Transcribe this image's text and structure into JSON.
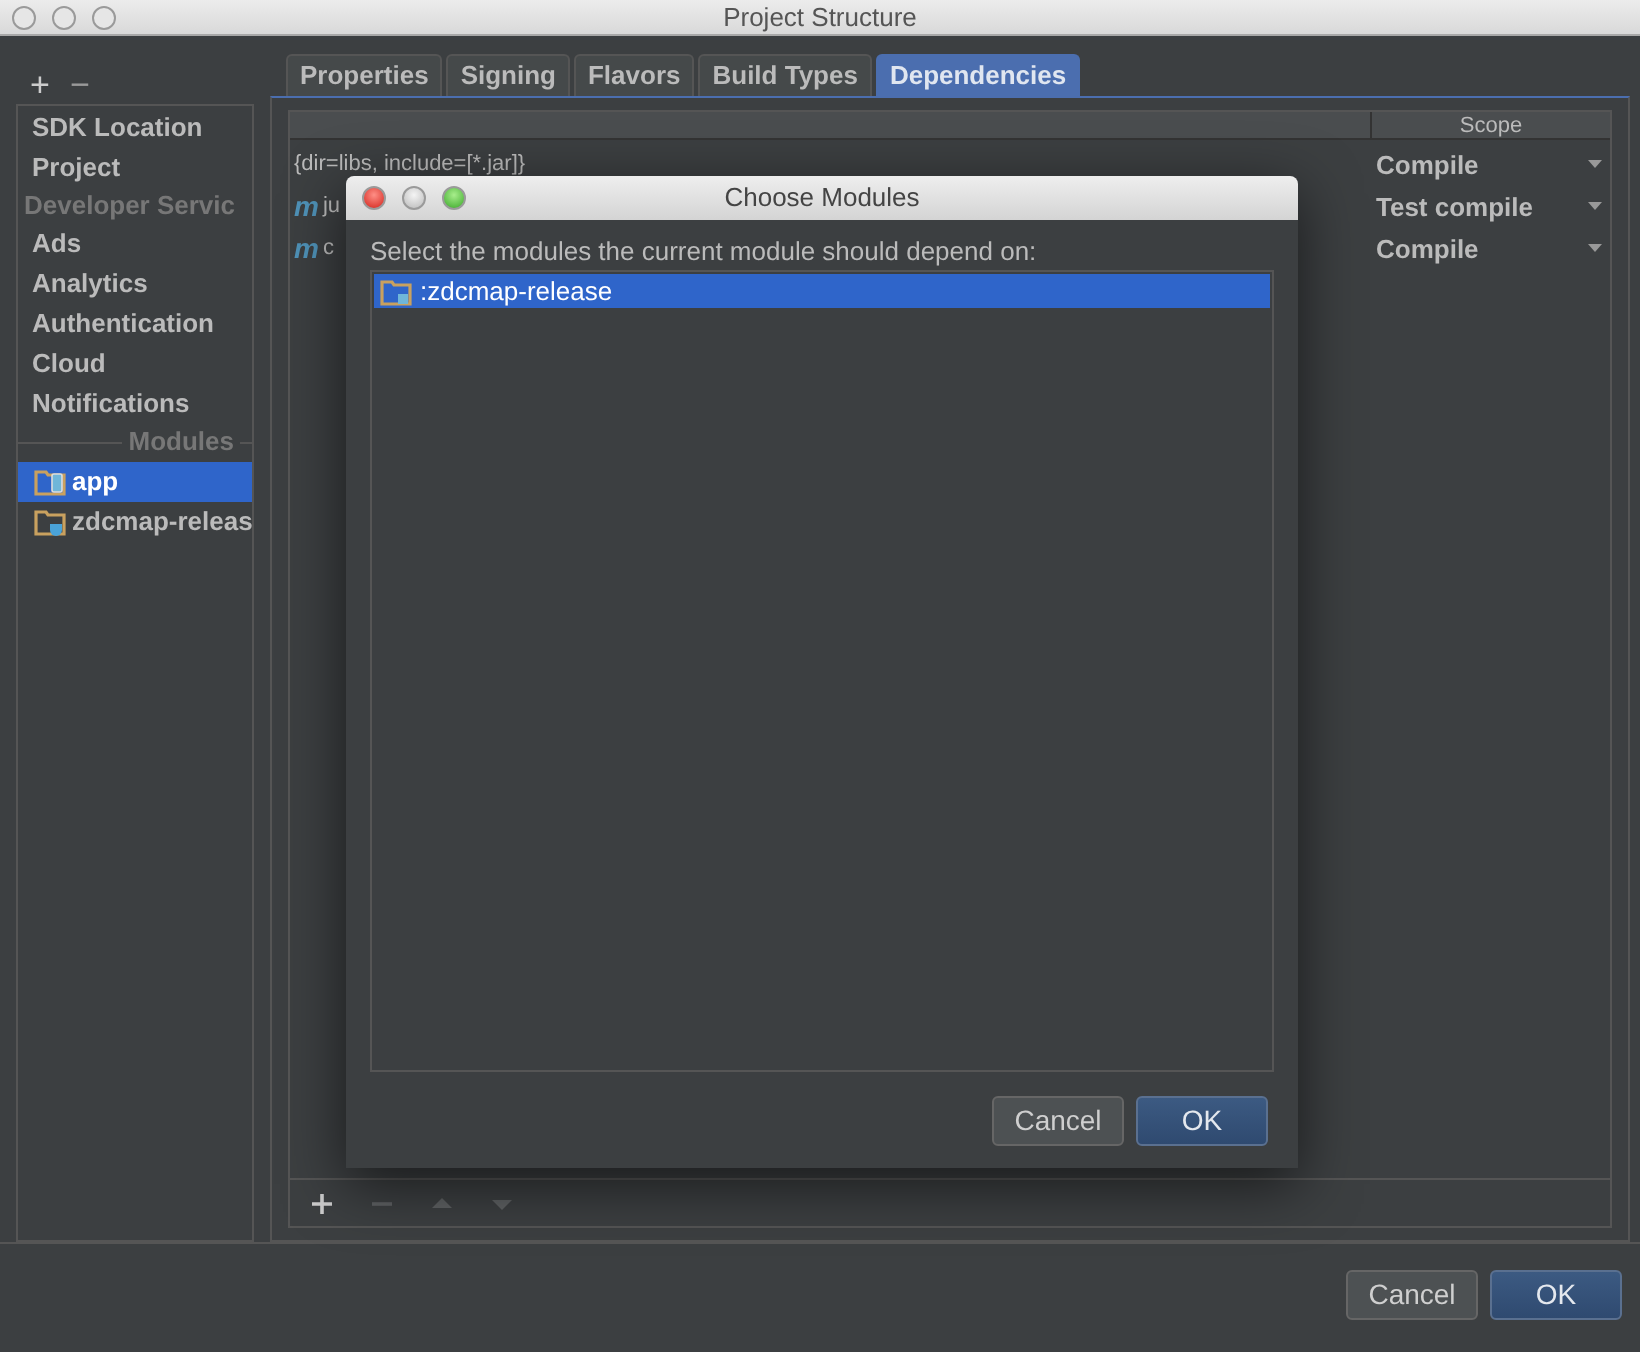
{
  "window": {
    "title": "Project Structure"
  },
  "sidebar": {
    "toolbar": [
      "+",
      "−"
    ],
    "items": [
      {
        "kind": "item",
        "label": "SDK Location",
        "selected": false
      },
      {
        "kind": "item",
        "label": "Project",
        "selected": false
      },
      {
        "kind": "header",
        "label": "Developer Servic"
      },
      {
        "kind": "item",
        "label": "Ads",
        "selected": false
      },
      {
        "kind": "item",
        "label": "Analytics",
        "selected": false
      },
      {
        "kind": "item",
        "label": "Authentication",
        "selected": false
      },
      {
        "kind": "item",
        "label": "Cloud",
        "selected": false
      },
      {
        "kind": "item",
        "label": "Notifications",
        "selected": false
      },
      {
        "kind": "separator",
        "label": "Modules"
      },
      {
        "kind": "app-module",
        "label": "app",
        "selected": true
      },
      {
        "kind": "library-module",
        "label": "zdcmap-releas",
        "selected": false
      }
    ]
  },
  "tabs": [
    {
      "label": "Properties",
      "selected": false
    },
    {
      "label": "Signing",
      "selected": false
    },
    {
      "label": "Flavors",
      "selected": false
    },
    {
      "label": "Build Types",
      "selected": false
    },
    {
      "label": "Dependencies",
      "selected": true
    }
  ],
  "table": {
    "columns": [
      "Scope"
    ],
    "rows": [
      {
        "kind": "files",
        "name": "{dir=libs, include=[*.jar]}",
        "scope": "Compile"
      },
      {
        "kind": "maven",
        "icon": "m",
        "name": "ju",
        "scope": "Test compile"
      },
      {
        "kind": "maven",
        "icon": "m",
        "name": "c",
        "scope": "Compile"
      }
    ]
  },
  "table_toolbar": [
    {
      "kind": "add",
      "disabled": false
    },
    {
      "kind": "remove",
      "disabled": true
    },
    {
      "kind": "up",
      "disabled": true
    },
    {
      "kind": "down",
      "disabled": true
    }
  ],
  "buttons": [
    {
      "label": "Cancel",
      "default": false
    },
    {
      "label": "OK",
      "default": true
    }
  ],
  "dialog": {
    "title": "Choose Modules",
    "prompt": "Select the modules the current module should depend on:",
    "items": [
      {
        "label": ":zdcmap-release",
        "selected": true
      }
    ],
    "buttons": [
      {
        "label": "Cancel",
        "default": false
      },
      {
        "label": "OK",
        "default": true
      }
    ]
  }
}
